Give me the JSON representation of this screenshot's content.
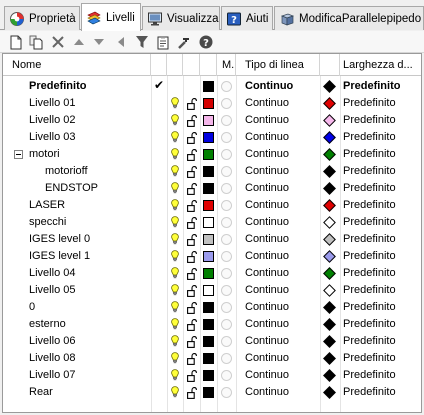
{
  "tabs": [
    {
      "label": "Proprietà",
      "icon": "properties-icon"
    },
    {
      "label": "Livelli",
      "icon": "layers-icon",
      "active": true
    },
    {
      "label": "Visualizza",
      "icon": "monitor-icon"
    },
    {
      "label": "Aiuti",
      "icon": "help-icon"
    },
    {
      "label": "ModificaParallelepipedo",
      "icon": "box-edit-icon"
    }
  ],
  "toolbar": [
    "new-layer-icon",
    "new-sublayer-icon",
    "delete-icon",
    "move-up-icon",
    "move-down-icon",
    "move-to-parent-icon",
    "filter-icon",
    "clipboard-icon",
    "tools-icon",
    "help-icon"
  ],
  "columns": {
    "name": "Nome",
    "material": "M...",
    "linetype": "Tipo di linea",
    "printwidth": "Larghezza d..."
  },
  "current_mark": "✔",
  "layers": [
    {
      "name": "Predefinito",
      "indent": 0,
      "bold": true,
      "current": true,
      "show_bulb": false,
      "color": "#000000",
      "linetype": "Continuo",
      "print_color": "#000000",
      "print_width": "Predefinito"
    },
    {
      "name": "Livello 01",
      "indent": 0,
      "color": "#d40000",
      "linetype": "Continuo",
      "print_color": "#e00000",
      "print_width": "Predefinito"
    },
    {
      "name": "Livello 02",
      "indent": 0,
      "color": "#f4b6ea",
      "linetype": "Continuo",
      "print_color": "#f6b8ec",
      "print_width": "Predefinito"
    },
    {
      "name": "Livello 03",
      "indent": 0,
      "color": "#0000e0",
      "linetype": "Continuo",
      "print_color": "#0000e8",
      "print_width": "Predefinito"
    },
    {
      "name": "motori",
      "indent": 0,
      "expanded": true,
      "color": "#008000",
      "linetype": "Continuo",
      "print_color": "#008000",
      "print_width": "Predefinito"
    },
    {
      "name": "motorioff",
      "indent": 1,
      "color": "#000000",
      "linetype": "Continuo",
      "print_color": "#000000",
      "print_width": "Predefinito"
    },
    {
      "name": "ENDSTOP",
      "indent": 1,
      "color": "#000000",
      "linetype": "Continuo",
      "print_color": "#000000",
      "print_width": "Predefinito"
    },
    {
      "name": "LASER",
      "indent": 0,
      "color": "#e00000",
      "linetype": "Continuo",
      "print_color": "#e00000",
      "print_width": "Predefinito"
    },
    {
      "name": "specchi",
      "indent": 0,
      "color": "#ffffff",
      "linetype": "Continuo",
      "print_color": "#ffffff",
      "print_width": "Predefinito"
    },
    {
      "name": "IGES level 0",
      "indent": 0,
      "color": "#c0c0c0",
      "linetype": "Continuo",
      "print_color": "#c0c0c0",
      "print_width": "Predefinito"
    },
    {
      "name": "IGES level 1",
      "indent": 0,
      "color": "#9a9aec",
      "linetype": "Continuo",
      "print_color": "#9a9aec",
      "print_width": "Predefinito"
    },
    {
      "name": "Livello 04",
      "indent": 0,
      "color": "#008000",
      "linetype": "Continuo",
      "print_color": "#008000",
      "print_width": "Predefinito"
    },
    {
      "name": "Livello 05",
      "indent": 0,
      "color": "#ffffff",
      "linetype": "Continuo",
      "print_color": "#ffffff",
      "print_width": "Predefinito"
    },
    {
      "name": "0",
      "indent": 0,
      "color": "#000000",
      "linetype": "Continuo",
      "print_color": "#000000",
      "print_width": "Predefinito"
    },
    {
      "name": "esterno",
      "indent": 0,
      "color": "#000000",
      "linetype": "Continuo",
      "print_color": "#000000",
      "print_width": "Predefinito"
    },
    {
      "name": "Livello 06",
      "indent": 0,
      "color": "#000000",
      "linetype": "Continuo",
      "print_color": "#000000",
      "print_width": "Predefinito"
    },
    {
      "name": "Livello 08",
      "indent": 0,
      "color": "#000000",
      "linetype": "Continuo",
      "print_color": "#000000",
      "print_width": "Predefinito"
    },
    {
      "name": "Livello 07",
      "indent": 0,
      "color": "#000000",
      "linetype": "Continuo",
      "print_color": "#000000",
      "print_width": "Predefinito"
    },
    {
      "name": "Rear",
      "indent": 0,
      "color": "#000000",
      "linetype": "Continuo",
      "print_color": "#000000",
      "print_width": "Predefinito"
    }
  ]
}
